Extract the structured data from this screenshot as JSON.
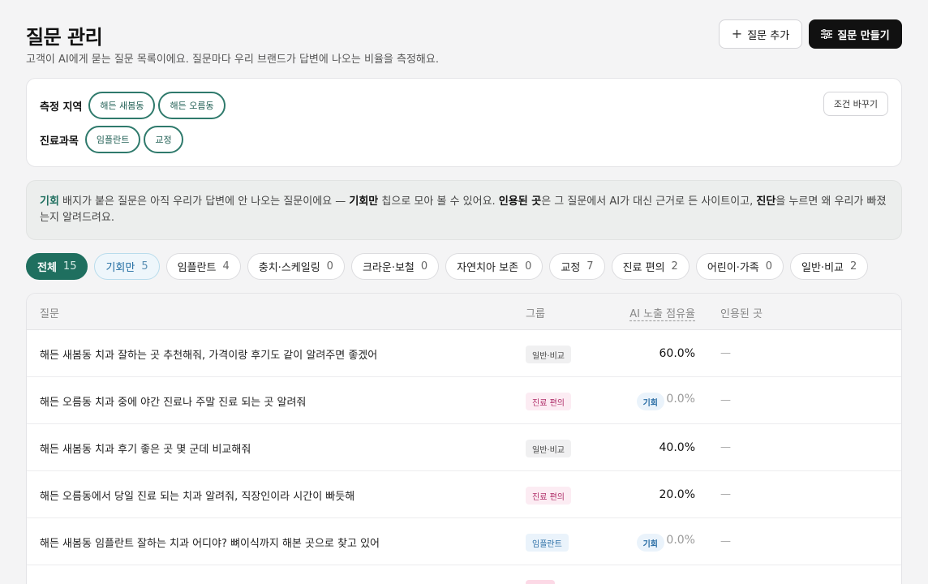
{
  "header": {
    "title": "질문 관리",
    "subtitle": "고객이 AI에게 묻는 질문 목록이에요. 질문마다 우리 브랜드가 답변에 나오는 비율을 측정해요.",
    "add_button": "질문 추가",
    "make_button": "질문 만들기"
  },
  "filters": {
    "region_label": "측정 지역",
    "regions": [
      "해든 새봄동",
      "해든 오름동"
    ],
    "dept_label": "진료과목",
    "depts": [
      "임플란트",
      "교정"
    ],
    "change_button": "조건 바꾸기"
  },
  "info": {
    "t1": "기회",
    "t2": " 배지가 붙은 질문은 아직 우리가 답변에 안 나오는 질문이에요 — ",
    "t3": "기회만",
    "t4": " 칩으로 모아 볼 수 있어요. ",
    "t5": "인용된 곳",
    "t6": "은 그 질문에서 AI가 대신 근거로 든 사이트이고, ",
    "t7": "진단",
    "t8": "을 누르면 왜 우리가 빠졌는지 알려드려요."
  },
  "tabs": [
    {
      "label": "전체",
      "count": "15"
    },
    {
      "label": "기회만",
      "count": "5"
    },
    {
      "label": "임플란트",
      "count": "4"
    },
    {
      "label": "충치·스케일링",
      "count": "0"
    },
    {
      "label": "크라운·보철",
      "count": "0"
    },
    {
      "label": "자연치아 보존",
      "count": "0"
    },
    {
      "label": "교정",
      "count": "7"
    },
    {
      "label": "진료 편의",
      "count": "2"
    },
    {
      "label": "어린이·가족",
      "count": "0"
    },
    {
      "label": "일반·비교",
      "count": "2"
    }
  ],
  "table": {
    "headers": {
      "question": "질문",
      "group": "그룹",
      "ai_share": "AI 노출 점유율",
      "cited": "인용된 곳"
    },
    "opp_label": "기회",
    "rows": [
      {
        "question": "해든 새봄동 치과 잘하는 곳 추천해줘, 가격이랑 후기도 같이 알려주면 좋겠어",
        "group": "일반·비교",
        "share": "60.0%",
        "cited": "—"
      },
      {
        "question": "해든 오름동 치과 중에 야간 진료나 주말 진료 되는 곳 알려줘",
        "group": "진료 편의",
        "share": "0.0%",
        "cited": "—"
      },
      {
        "question": "해든 새봄동 치과 후기 좋은 곳 몇 군데 비교해줘",
        "group": "일반·비교",
        "share": "40.0%",
        "cited": "—"
      },
      {
        "question": "해든 오름동에서 당일 진료 되는 치과 알려줘, 직장인이라 시간이 빠듯해",
        "group": "진료 편의",
        "share": "20.0%",
        "cited": "—"
      },
      {
        "question": "해든 새봄동 임플란트 잘하는 치과 어디야? 뼈이식까지 해본 곳으로 찾고 있어",
        "group": "임플란트",
        "share": "0.0%",
        "cited": "—"
      }
    ]
  }
}
